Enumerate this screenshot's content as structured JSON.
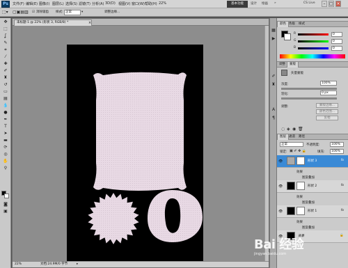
{
  "menubar": {
    "logo": "Ps",
    "items": [
      "文件(F)",
      "编辑(E)",
      "图像(I)",
      "图层(L)",
      "选择(S)",
      "滤镜(T)",
      "分析(A)",
      "3D(D)",
      "视图(V)",
      "窗口(W)",
      "帮助(H)"
    ],
    "zoom": "22%",
    "workspace_active": "基本功能",
    "workspaces": [
      "设计",
      "绘画"
    ],
    "cs_live": "CS Live"
  },
  "options": {
    "anti_alias": "消除锯齿",
    "style_label": "样式:",
    "style_value": "正常",
    "refine": "调整边缘..."
  },
  "document": {
    "tab_title": "未标题-1 @ 22% (形状 3, RGB/8) *",
    "zoom_status": "22%",
    "doc_status": "文档:24.9M/0 字节"
  },
  "panels": {
    "color_tabs": [
      "颜色",
      "色板",
      "样式"
    ],
    "adj_tabs": [
      "调整",
      "蒙版"
    ],
    "mask_title": "矢量蒙版",
    "density_label": "浓度:",
    "density_value": "100%",
    "feather_label": "羽化:",
    "feather_value": "0 px",
    "refine_label": "调整:",
    "mask_edge": "蒙版边缘...",
    "color_range": "颜色范围...",
    "invert": "反相",
    "layer_tabs": [
      "图层",
      "通道",
      "路径"
    ],
    "blend_mode": "正常",
    "opacity_label": "不透明度:",
    "opacity_value": "100%",
    "lock_label": "锁定:",
    "fill_label": "填充:",
    "fill_value": "100%",
    "layers": [
      {
        "name": "形状 3",
        "fx": "fx",
        "effects": "效果",
        "effect": "图案叠加"
      },
      {
        "name": "形状 2",
        "fx": "fx",
        "effects": "效果",
        "effect": "图案叠加"
      },
      {
        "name": "形状 1",
        "fx": "fx",
        "effects": "效果",
        "effect": "图案叠加"
      },
      {
        "name": "背景"
      }
    ]
  },
  "colors": {
    "shape_fill": "#e8d9e4",
    "highlight": "#3a8ad6",
    "panel_bg": "#cbcbcb"
  },
  "watermark": "Bai 经验",
  "watermark_sub": "jingyan.baidu.com"
}
